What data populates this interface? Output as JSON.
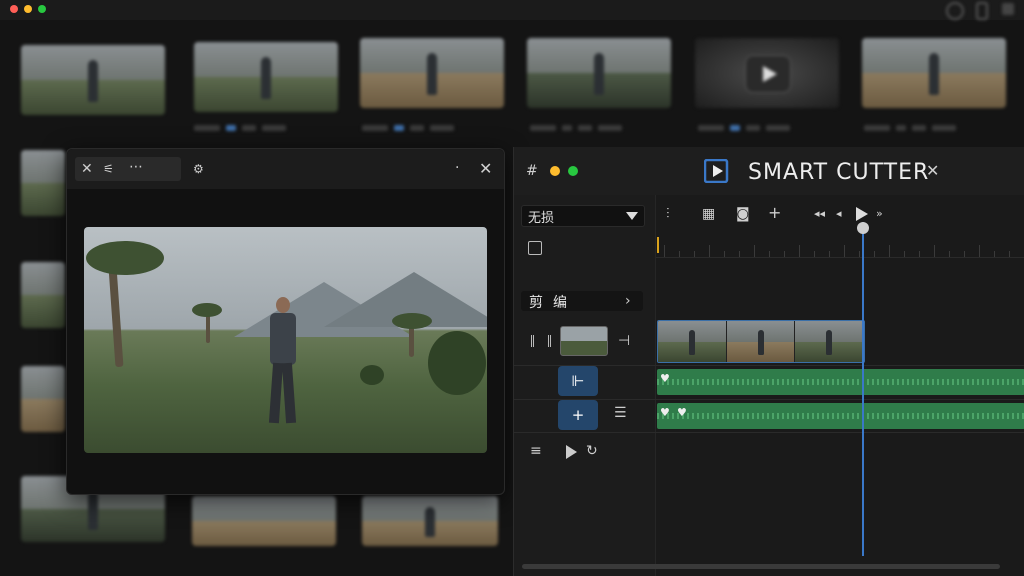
{
  "window": {
    "traffic_lights": [
      "#ff5f57",
      "#febc2e",
      "#28c840"
    ]
  },
  "background_grid": {
    "thumbnails": [
      {
        "scene": "field"
      },
      {
        "scene": "field"
      },
      {
        "scene": "sand"
      },
      {
        "scene": "dim"
      },
      {
        "scene": "play"
      },
      {
        "scene": "sand"
      }
    ]
  },
  "preview_window": {
    "close_icon": "close-icon",
    "tab_icon": "sliders-icon",
    "menu_icon": "more-icon",
    "filter_icon": "adjust-icon"
  },
  "editor": {
    "title": "SMART CUTTER",
    "mode_select": "无损",
    "section_label": "剪编",
    "accent": "#3a78c8",
    "audio_color": "#2f7c4a",
    "toolbar_icons": [
      "waveform-icon",
      "grid-icon",
      "camera-icon",
      "plus-icon",
      "rewind-icon",
      "step-back-icon",
      "play-icon",
      "forward-icon"
    ]
  }
}
